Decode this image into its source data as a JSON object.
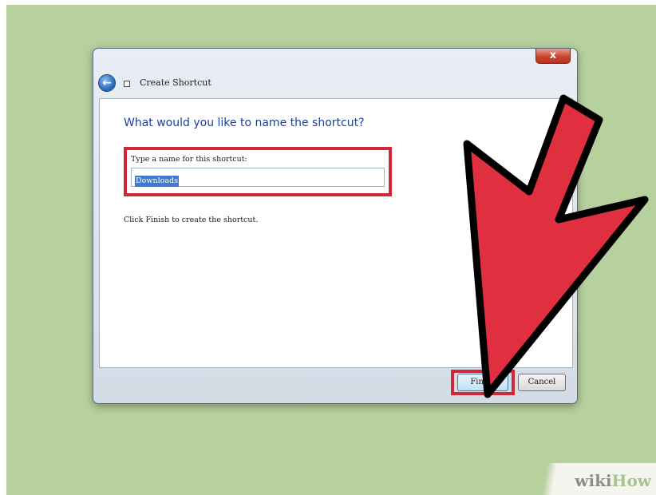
{
  "window": {
    "title": "Create Shortcut",
    "close_glyph": "x",
    "back_glyph": "←"
  },
  "content": {
    "heading": "What would you like to name the shortcut?",
    "name_field_label": "Type a name for this shortcut:",
    "name_field_value": "Downloads",
    "instruction": "Click Finish to create the shortcut."
  },
  "buttons": {
    "finish": "Finish",
    "cancel": "Cancel"
  },
  "annotations": {
    "highlight_color": "#d0273a",
    "arrow_color": "#e03040"
  },
  "watermark": {
    "wiki": "wiki",
    "how": "How"
  },
  "icons": [
    "back-arrow-icon",
    "shortcut-icon",
    "close-icon"
  ]
}
